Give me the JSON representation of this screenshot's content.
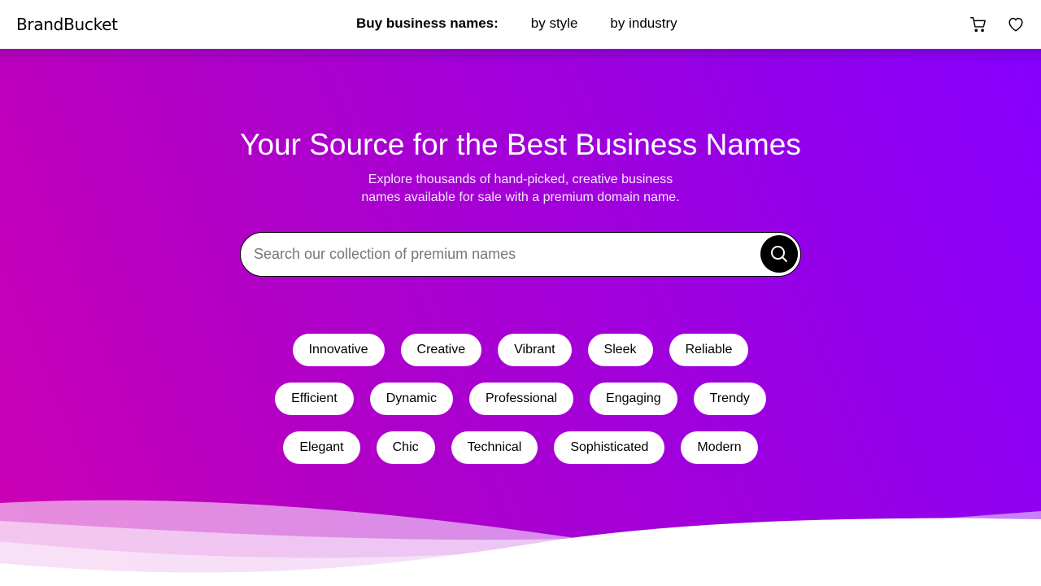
{
  "header": {
    "logo": "BrandBucket",
    "nav_title": "Buy business names:",
    "nav_links": [
      "by style",
      "by industry"
    ],
    "icons": [
      "cart-icon",
      "heart-icon"
    ]
  },
  "hero": {
    "title": "Your Source for the Best Business Names",
    "subtitle_line1": "Explore thousands of hand-picked, creative business",
    "subtitle_line2": "names available for sale with a premium domain name.",
    "search_placeholder": "Search our collection of premium names",
    "search_value": "",
    "search_icon": "search-icon"
  },
  "styles": [
    [
      "Innovative",
      "Creative",
      "Vibrant",
      "Sleek",
      "Reliable"
    ],
    [
      "Efficient",
      "Dynamic",
      "Professional",
      "Engaging",
      "Trendy"
    ],
    [
      "Elegant",
      "Chic",
      "Technical",
      "Sophisticated",
      "Modern"
    ]
  ],
  "colors": {
    "gradient_start": "#cc00b4",
    "gradient_end": "#8600ff",
    "chip_bg": "#ffffff",
    "search_button": "#000000"
  }
}
